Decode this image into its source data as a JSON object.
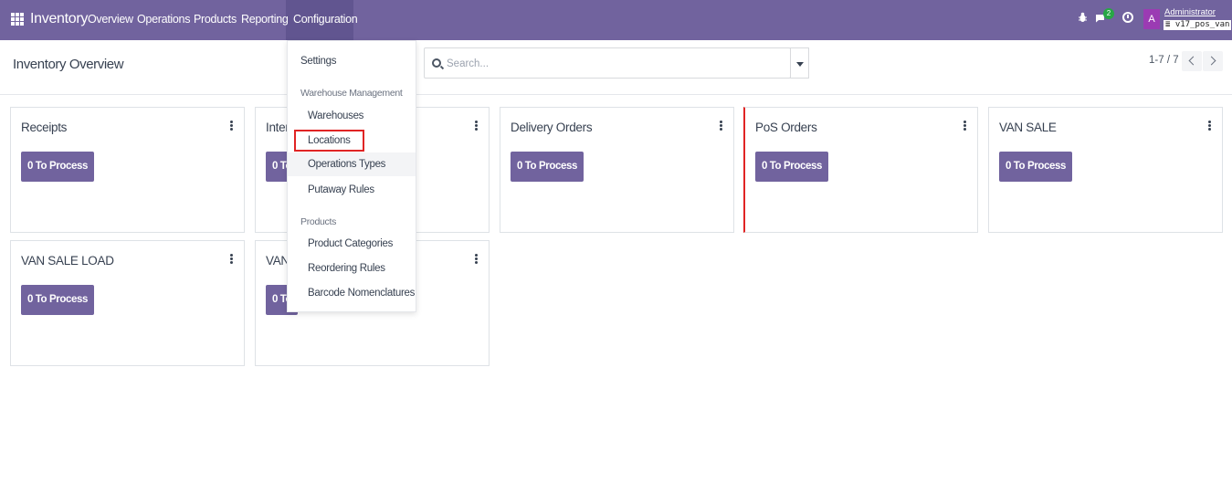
{
  "navbar": {
    "app_name": "Inventory",
    "menu": [
      "Overview",
      "Operations",
      "Products",
      "Reporting",
      "Configuration"
    ],
    "chat_count": "2",
    "avatar_letter": "A",
    "user_name": "Administrator",
    "database": "v17_pos_van",
    "icons": [
      "apps-grid-icon",
      "bug-icon",
      "chat-icon",
      "clock-icon"
    ]
  },
  "control_panel": {
    "title": "Inventory Overview",
    "search_placeholder": "Search...",
    "pager": "1-7 / 7"
  },
  "cards": [
    {
      "title": "Receipts",
      "button": "0 To Process"
    },
    {
      "title": "Inter",
      "button": "0 To"
    },
    {
      "title": "Delivery Orders",
      "button": "0 To Process"
    },
    {
      "title": "PoS Orders",
      "button": "0 To Process"
    },
    {
      "title": "VAN SALE",
      "button": "0 To Process"
    },
    {
      "title": "VAN SALE LOAD",
      "button": "0 To Process"
    },
    {
      "title": "VAN",
      "button": "0 To"
    }
  ],
  "config_menu": {
    "settings": "Settings",
    "warehouse_header": "Warehouse Management",
    "warehouse_items": [
      "Warehouses",
      "Locations",
      "Operations Types",
      "Putaway Rules"
    ],
    "products_header": "Products",
    "products_items": [
      "Product Categories",
      "Reordering Rules",
      "Barcode Nomenclatures"
    ]
  },
  "colors": {
    "brand": "#71639e",
    "highlight": "#e02424",
    "badge": "#28a745"
  }
}
